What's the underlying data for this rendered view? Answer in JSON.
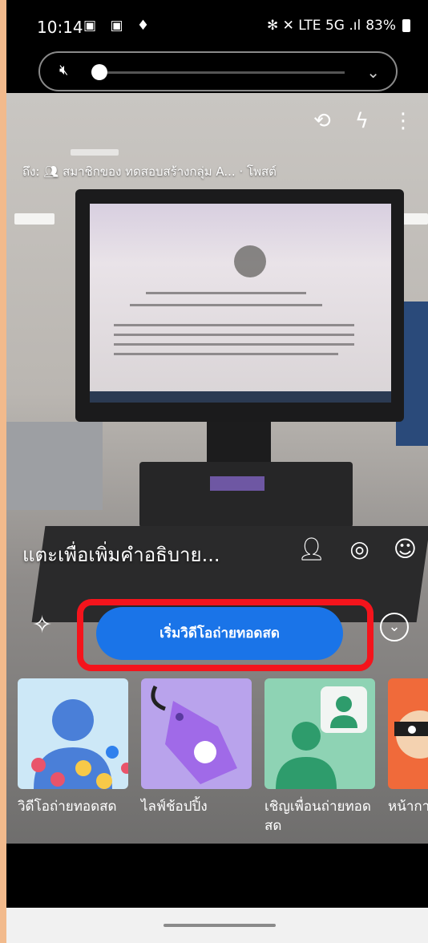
{
  "status_bar": {
    "time": "10:14",
    "right_icons": "✻ ✕ LTE 5G .ıl",
    "battery": "83%"
  },
  "volume_panel": {
    "level": 0.0,
    "muted": true
  },
  "post_target": {
    "prefix": "ถึง:",
    "audience": "สมาชิกของ ทดสอบสร้างกลุ่ม A...",
    "separator": "·",
    "type": "โพสต์"
  },
  "caption": {
    "placeholder": "แตะเพื่อเพิ่มคำอธิบาย..."
  },
  "live_button": {
    "label": "เริ่มวิดีโอถ่ายทอดสด"
  },
  "effects": [
    {
      "label": "วิดีโอถ่ายทอดสด"
    },
    {
      "label": "ไลฟ์ช้อปปิ้ง"
    },
    {
      "label": "เชิญเพื่อนถ่ายทอดสด"
    },
    {
      "label": "หน้ากา"
    }
  ],
  "colors": {
    "accent_blue": "#1a74e8",
    "highlight_red": "#f4141c",
    "page_bg": "#f2ba8c"
  },
  "icons": {
    "camera_controls": [
      "switch-camera-icon",
      "flash-off-icon",
      "more-vertical-icon"
    ],
    "caption_tools": [
      "tag-people-icon",
      "location-icon",
      "emoji-icon"
    ]
  }
}
